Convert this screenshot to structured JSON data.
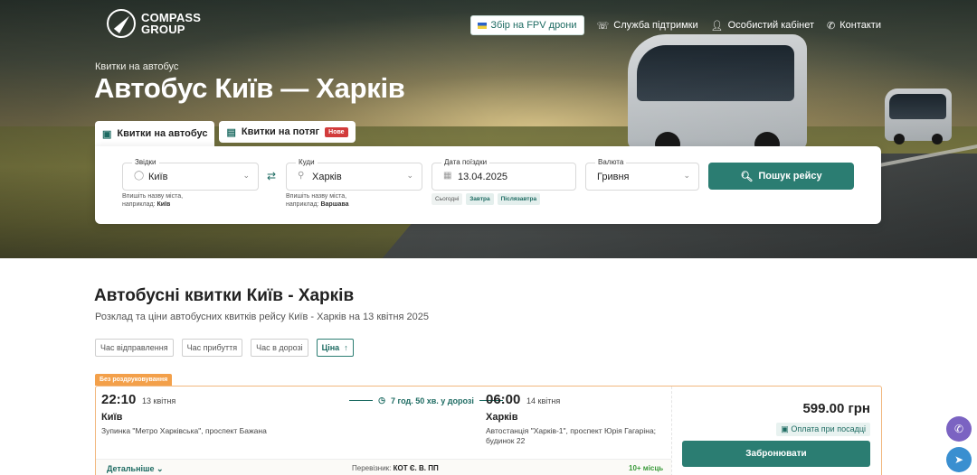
{
  "header": {
    "logo_line1": "COMPASS",
    "logo_line2": "GROUP",
    "fpv_label": "Збір на FPV дрони",
    "support_label": "Служба підтримки",
    "account_label": "Особистий кабінет",
    "contacts_label": "Контакти"
  },
  "hero": {
    "eyebrow": "Квитки на автобус",
    "title": "Автобус Київ — Харків"
  },
  "tabs": [
    {
      "label": "Квитки на автобус",
      "active": true,
      "icon": "bus-icon"
    },
    {
      "label": "Квитки на потяг",
      "active": false,
      "icon": "train-icon",
      "badge": "Нове"
    }
  ],
  "search": {
    "from_label": "Звідки",
    "from_value": "Київ",
    "from_hint": "Впишіть назву міста,",
    "from_hint2_prefix": "наприклад:",
    "from_hint2_example": "Київ",
    "to_label": "Куди",
    "to_value": "Харків",
    "to_hint": "Впишіть назву міста,",
    "to_hint2_prefix": "наприклад:",
    "to_hint2_example": "Варшава",
    "date_label": "Дата поїздки",
    "date_value": "13.04.2025",
    "date_chips": [
      "Сьогодні",
      "Завтра",
      "Післязавтра"
    ],
    "currency_label": "Валюта",
    "currency_value": "Гривня",
    "button_label": "Пошук рейсу"
  },
  "main": {
    "title": "Автобусні квитки Київ - Харків",
    "subtitle": "Розклад та ціни автобусних квитків рейсу Київ - Харків на 13 квітня 2025",
    "sorts": [
      "Час відправлення",
      "Час прибуття",
      "Час в дорозі",
      "Ціна"
    ],
    "active_sort_arrow": "↑"
  },
  "trip": {
    "badge": "Без роздруковування",
    "dep_time": "22:10",
    "dep_date": "13 квітня",
    "dep_city": "Київ",
    "dep_stop": "Зупинка \"Метро Харківська\", проспект Бажана",
    "duration": "7 год. 50 хв. у дорозі",
    "arr_time": "06:00",
    "arr_date": "14 квітня",
    "arr_city": "Харків",
    "arr_stop_line1": "Автостанція \"Харків-1\", проспект Юрія Гагаріна;",
    "arr_stop_line2": "будинок 22",
    "price": "599.00 грн",
    "payment": "Оплата при посадці",
    "book_label": "Забронювати",
    "more_label": "Детальніше",
    "carrier_prefix": "Перевізник:",
    "carrier_name": "КОТ Є. В. ПП",
    "seats": "10+ місць"
  },
  "colors": {
    "accent": "#2b7d72",
    "badge_orange": "#f3a04a",
    "new_badge": "#d23b3b"
  }
}
